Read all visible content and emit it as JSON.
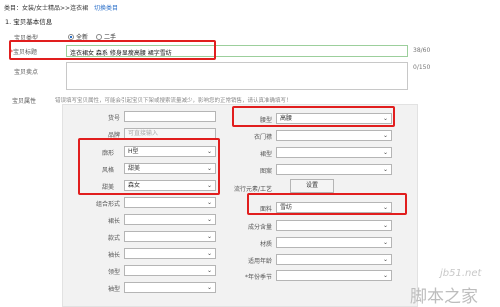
{
  "breadcrumb": {
    "prefix": "类目：女装/女士精品>>连衣裙",
    "switch_label": "切换类目"
  },
  "section_title": "1. 宝贝基本信息",
  "type_row": {
    "label": "宝贝类型",
    "option_new": "全新",
    "option_used": "二手"
  },
  "title_row": {
    "label": "宝贝标题",
    "value": "连衣裙女 森系 修身显瘦高腰 裙字雪纺",
    "counter": "38/60"
  },
  "selling_row": {
    "label": "宝贝卖点",
    "counter": "0/150"
  },
  "attrs": {
    "label": "宝贝属性",
    "hint": "错误填写宝贝属性，可能会引起宝贝下架或搜索流量减少，影响您的正常销售，请认真准确填写！",
    "left": [
      {
        "label": "货号",
        "value": "",
        "kind": "input"
      },
      {
        "label": "品牌",
        "value": "可直接输入",
        "kind": "placeholder"
      },
      {
        "label": "廓形",
        "value": "H型",
        "kind": "select"
      },
      {
        "label": "风格",
        "value": "甜美",
        "kind": "select"
      },
      {
        "label": "甜美",
        "value": "森女",
        "kind": "select"
      },
      {
        "label": "组合形式",
        "value": "",
        "kind": "select"
      },
      {
        "label": "裙长",
        "value": "",
        "kind": "select"
      },
      {
        "label": "款式",
        "value": "",
        "kind": "select"
      },
      {
        "label": "袖长",
        "value": "",
        "kind": "select"
      },
      {
        "label": "领型",
        "value": "",
        "kind": "select"
      },
      {
        "label": "袖型",
        "value": "",
        "kind": "select"
      }
    ],
    "right": [
      {
        "label": "腰型",
        "value": "高腰",
        "kind": "select"
      },
      {
        "label": "衣门襟",
        "value": "",
        "kind": "select"
      },
      {
        "label": "裙型",
        "value": "",
        "kind": "select"
      },
      {
        "label": "图案",
        "value": "",
        "kind": "select"
      },
      {
        "label": "流行元素/工艺",
        "value": "设置",
        "kind": "button"
      },
      {
        "label": "面料",
        "value": "雪纺",
        "kind": "select"
      },
      {
        "label": "成分含量",
        "value": "",
        "kind": "select"
      },
      {
        "label": "材质",
        "value": "",
        "kind": "select"
      },
      {
        "label": "适用年龄",
        "value": "",
        "kind": "select"
      },
      {
        "label": "*年份季节",
        "value": "",
        "kind": "select"
      }
    ]
  },
  "watermark": {
    "line1": "jb51.net",
    "line2": "脚本之家"
  },
  "colors": {
    "highlight": "#e11e1e",
    "link": "#2a6fc9"
  }
}
